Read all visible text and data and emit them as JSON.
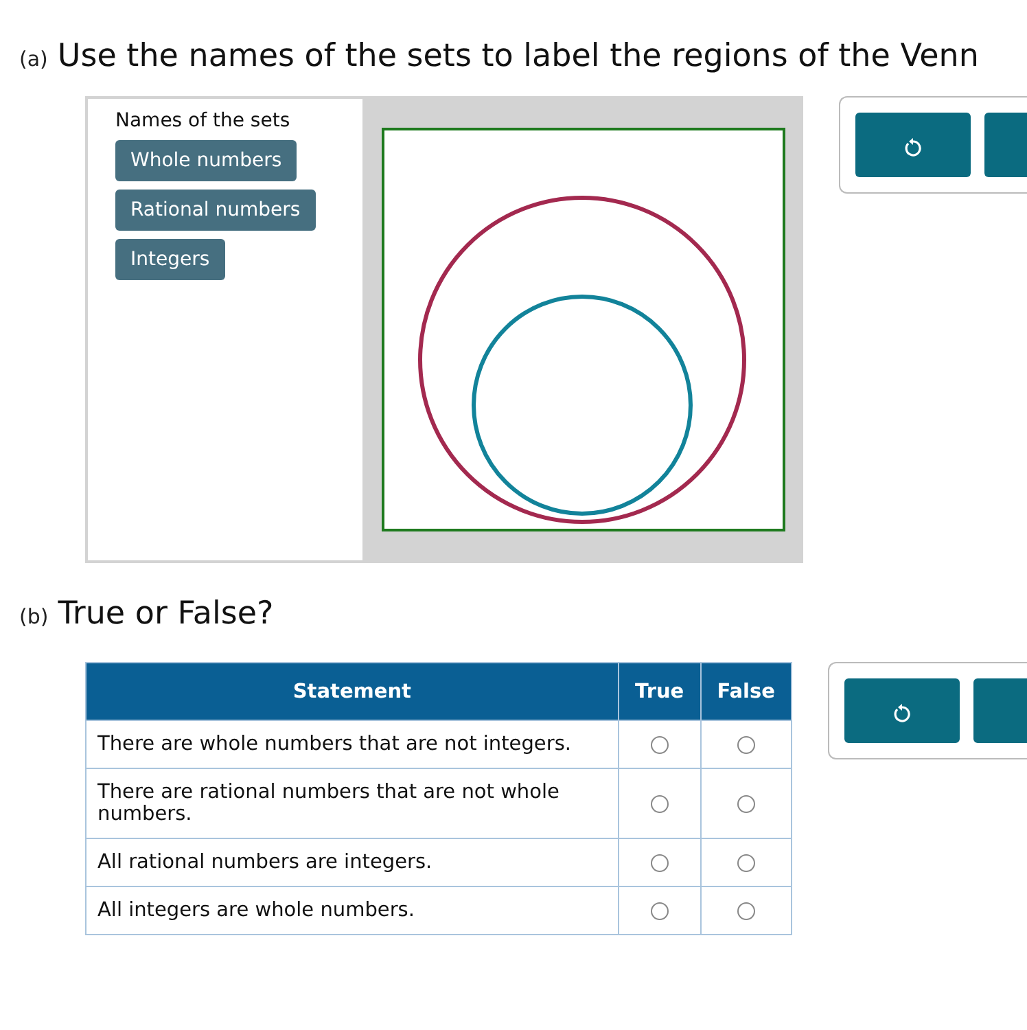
{
  "part_a": {
    "label": "(a)",
    "prompt": "Use the names of the sets to label the regions of the Venn",
    "sets_panel": {
      "title": "Names of the sets",
      "chips": [
        "Whole numbers",
        "Rational numbers",
        "Integers"
      ]
    },
    "diagram": {
      "kind": "venn"
    }
  },
  "part_b": {
    "label": "(b)",
    "prompt": "True or False?",
    "table": {
      "columns": [
        "Statement",
        "True",
        "False"
      ],
      "rows": [
        {
          "statement": "There are whole numbers that are not integers.",
          "true_selected": false,
          "false_selected": false
        },
        {
          "statement": "There are rational numbers that are not whole numbers.",
          "true_selected": false,
          "false_selected": false
        },
        {
          "statement": "All rational numbers are integers.",
          "true_selected": false,
          "false_selected": false
        },
        {
          "statement": "All integers are whole numbers.",
          "true_selected": false,
          "false_selected": false
        }
      ]
    }
  }
}
